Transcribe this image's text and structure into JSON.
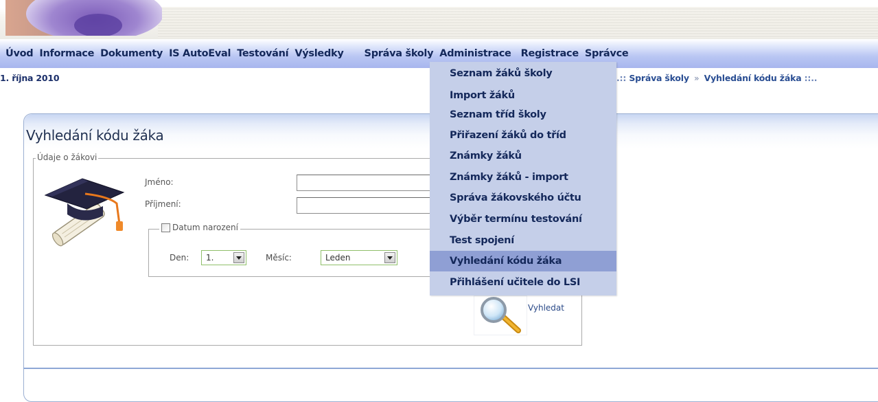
{
  "nav": {
    "items": [
      "Úvod",
      "Informace",
      "Dokumenty",
      "IS AutoEval",
      "Testování",
      "Výsledky",
      "Správa školy",
      "Administrace",
      "Registrace",
      "Správce"
    ]
  },
  "date": "1. října 2010",
  "breadcrumb": {
    "prefix": ".::",
    "section": "Správa školy",
    "separator": "»",
    "page": "Vyhledání kódu žáka",
    "suffix": "::.."
  },
  "panel": {
    "title": "Vyhledání kódu žáka",
    "fieldset_legend": "Údaje o žákovi"
  },
  "form": {
    "first_name_label": "Jméno:",
    "first_name_value": "",
    "last_name_label": "Příjmení:",
    "last_name_value": "",
    "birthdate_legend": "Datum narození",
    "birthdate_checked": false,
    "day_label": "Den:",
    "day_value": "1.",
    "month_label": "Měsíc:",
    "month_value": "Leden",
    "search_label": "Vyhledat"
  },
  "dropdown": {
    "items": [
      "Seznam žáků školy",
      "Import žáků",
      "Seznam tříd školy",
      "Přiřazení žáků do tříd",
      "Známky žáků",
      "Známky žáků - import",
      "Správa žákovského účtu",
      "Výběr termínu testování",
      "Test spojení",
      "Vyhledání kódu žáka",
      "Přihlášení učitele do LSI"
    ],
    "active_index": 9
  },
  "colors": {
    "nav_text": "#14285a",
    "dropdown_bg": "#c5cfe9",
    "dropdown_active": "#8f9fd4",
    "panel_border": "#9aaed1"
  }
}
